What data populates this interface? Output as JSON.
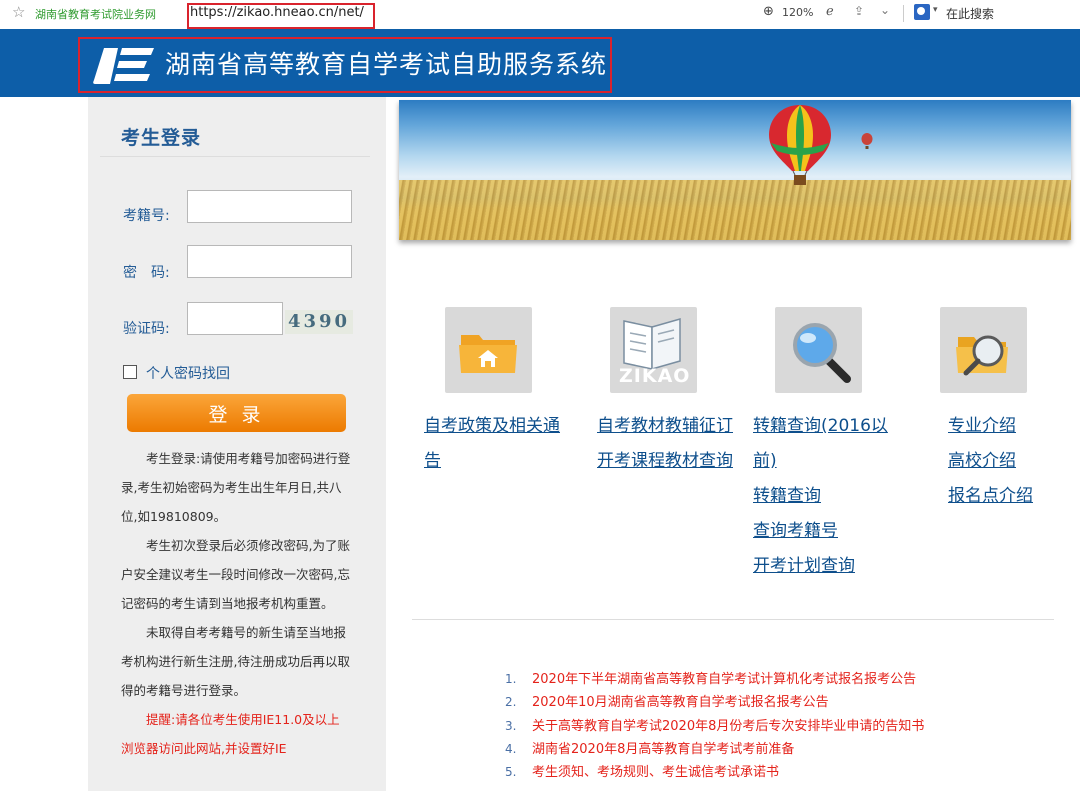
{
  "browser": {
    "tab_title": "湖南省教育考试院业务网",
    "url": "https://zikao.hneao.cn/net/",
    "zoom": "120%",
    "search_label": "在此搜索"
  },
  "header": {
    "title": "湖南省高等教育自学考试自助服务系统"
  },
  "login": {
    "title": "考生登录",
    "id_label": "考籍号:",
    "password_label": "密　码:",
    "captcha_label": "验证码:",
    "captcha_code": "4390",
    "recover_label": "个人密码找回",
    "login_button": "登 录",
    "notes": [
      "考生登录:请使用考籍号加密码进行登录,考生初始密码为考生出生年月日,共八位,如19810809。",
      "考生初次登录后必须修改密码,为了账户安全建议考生一段时间修改一次密码,忘记密码的考生请到当地报考机构重置。",
      "未取得自考考籍号的新生请至当地报考机构进行新生注册,待注册成功后再以取得的考籍号进行登录。"
    ],
    "warning": "提醒:请各位考生使用IE11.0及以上浏览器访问此网站,并设置好IE"
  },
  "services": [
    {
      "icon": "folder-home-icon",
      "links": [
        "自考政策及相关通",
        "告"
      ]
    },
    {
      "icon": "zikao-book-icon",
      "icon_text": "ZIKAO",
      "links": [
        "自考教材教辅征订",
        "开考课程教材查询"
      ]
    },
    {
      "icon": "magnifier-icon",
      "links": [
        "转籍查询(2016以",
        "前)",
        "转籍查询",
        "查询考籍号",
        "开考计划查询"
      ]
    },
    {
      "icon": "folder-search-icon",
      "links": [
        "专业介绍",
        "高校介绍",
        "报名点介绍"
      ]
    }
  ],
  "notices": [
    {
      "num": "1.",
      "text": "2020年下半年湖南省高等教育自学考试计算机化考试报名报考公告"
    },
    {
      "num": "2.",
      "text": "2020年10月湖南省高等教育自学考试报名报考公告"
    },
    {
      "num": "3.",
      "text": "关于高等教育自学考试2020年8月份考后专次安排毕业申请的告知书"
    },
    {
      "num": "4.",
      "text": "湖南省2020年8月高等教育自学考试考前准备"
    },
    {
      "num": "5.",
      "text": "考生须知、考场规则、考生诚信考试承诺书"
    }
  ],
  "colors": {
    "header_blue": "#0d5ea8",
    "link_blue": "#0e4f8c",
    "notice_red": "#e4231b",
    "button_orange": "#f28c10",
    "highlight_red": "#d9232d"
  }
}
